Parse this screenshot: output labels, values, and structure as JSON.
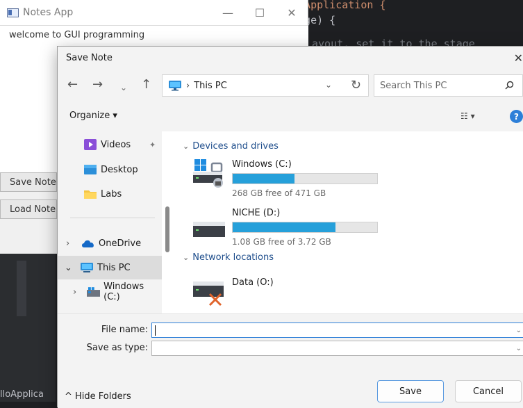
{
  "ide": {
    "code_line_1": "s Application {",
    "code_line_2": "tage) {",
    "code_line_3": "ayout, set it to the stage",
    "bottom_text": "lloApplica"
  },
  "notes_window": {
    "title": "Notes App",
    "text_content": "welcome to GUI programming",
    "save_button": "Save Note",
    "load_button": "Load Note",
    "minimize": "—",
    "maximize": "☐",
    "close": "✕"
  },
  "dialog": {
    "title": "Save Note",
    "close": "✕",
    "nav": {
      "back": "←",
      "forward": "→",
      "recent": "⌄",
      "up": "↑",
      "address": "This PC",
      "address_sep": "›",
      "address_dropdown": "⌄",
      "refresh": "↻",
      "search_placeholder": "Search This PC"
    },
    "toolbar": {
      "organize": "Organize ▾",
      "view": "☷ ▾",
      "help": "?"
    },
    "sidebar": {
      "items": [
        {
          "label": "Videos",
          "pin": "📌"
        },
        {
          "label": "Desktop"
        },
        {
          "label": "Labs"
        },
        {
          "label": "OneDrive",
          "expander": "›"
        },
        {
          "label": "This PC",
          "expander": "⌄"
        },
        {
          "label": "Windows (C:)",
          "expander": "›"
        }
      ]
    },
    "content": {
      "devices_header": "Devices and drives",
      "drives": [
        {
          "name": "Windows (C:)",
          "free_text": "268 GB free of 471 GB",
          "used_fraction": 0.43
        },
        {
          "name": "NICHE (D:)",
          "free_text": "1.08 GB free of 3.72 GB",
          "used_fraction": 0.71
        }
      ],
      "network_header": "Network locations",
      "network": [
        {
          "name": "Data (O:)"
        }
      ]
    },
    "footer": {
      "file_name_label": "File name:",
      "file_name_value": "",
      "save_as_type_label": "Save as type:",
      "save_as_type_value": "",
      "hide_folders": "^ Hide Folders",
      "save": "Save",
      "cancel": "Cancel"
    }
  },
  "colors": {
    "accent": "#26a0da",
    "link": "#1f4e8c",
    "help": "#2d7fd8"
  }
}
